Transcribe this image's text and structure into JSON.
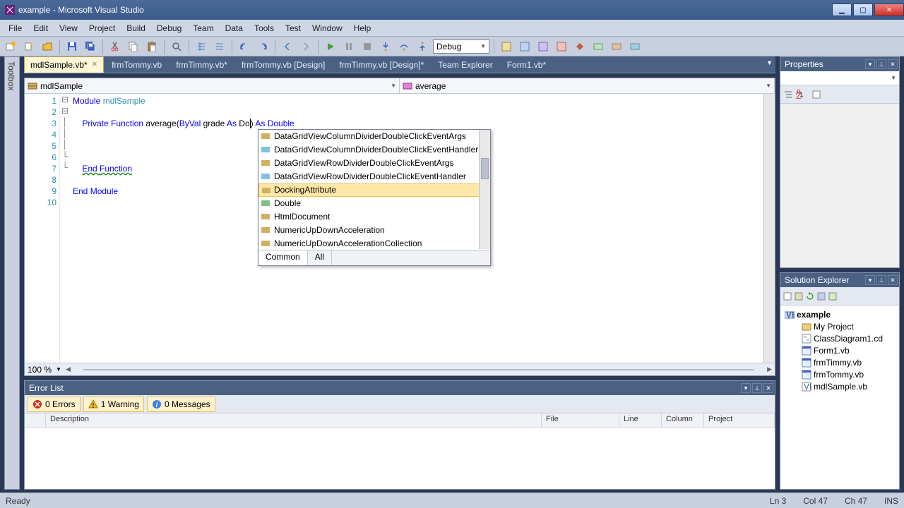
{
  "window": {
    "title": "example - Microsoft Visual Studio"
  },
  "menu": [
    "File",
    "Edit",
    "View",
    "Project",
    "Build",
    "Debug",
    "Team",
    "Data",
    "Tools",
    "Test",
    "Window",
    "Help"
  ],
  "toolbar": {
    "config": "Debug"
  },
  "doc_tabs": [
    {
      "label": "mdlSample.vb*",
      "active": true,
      "close": true
    },
    {
      "label": "frmTommy.vb",
      "active": false
    },
    {
      "label": "frmTimmy.vb*",
      "active": false
    },
    {
      "label": "frmTommy.vb [Design]",
      "active": false
    },
    {
      "label": "frmTimmy.vb [Design]*",
      "active": false
    },
    {
      "label": "Team Explorer",
      "active": false
    },
    {
      "label": "Form1.vb*",
      "active": false
    }
  ],
  "editor": {
    "left_dd": "mdlSample",
    "right_dd": "average",
    "zoom": "100 %",
    "lines": [
      "1",
      "2",
      "3",
      "4",
      "5",
      "6",
      "7",
      "8",
      "9",
      "10"
    ]
  },
  "intellisense": {
    "items": [
      "DataGridViewColumnDividerDoubleClickEventArgs",
      "DataGridViewColumnDividerDoubleClickEventHandler",
      "DataGridViewRowDividerDoubleClickEventArgs",
      "DataGridViewRowDividerDoubleClickEventHandler",
      "DockingAttribute",
      "Double",
      "HtmlDocument",
      "NumericUpDownAcceleration",
      "NumericUpDownAccelerationCollection"
    ],
    "selected": 4,
    "tabs": {
      "common": "Common",
      "all": "All"
    }
  },
  "error_list": {
    "title": "Error List",
    "errors": "0 Errors",
    "warnings": "1 Warning",
    "messages": "0 Messages",
    "cols": {
      "desc": "Description",
      "file": "File",
      "line": "Line",
      "col": "Column",
      "proj": "Project"
    }
  },
  "properties": {
    "title": "Properties"
  },
  "solution": {
    "title": "Solution Explorer",
    "root": "example",
    "items": [
      "My Project",
      "ClassDiagram1.cd",
      "Form1.vb",
      "frmTimmy.vb",
      "frmTommy.vb",
      "mdlSample.vb"
    ]
  },
  "left_tool": "Toolbox",
  "status": {
    "ready": "Ready",
    "ln": "Ln 3",
    "col": "Col 47",
    "ch": "Ch 47",
    "ins": "INS"
  }
}
